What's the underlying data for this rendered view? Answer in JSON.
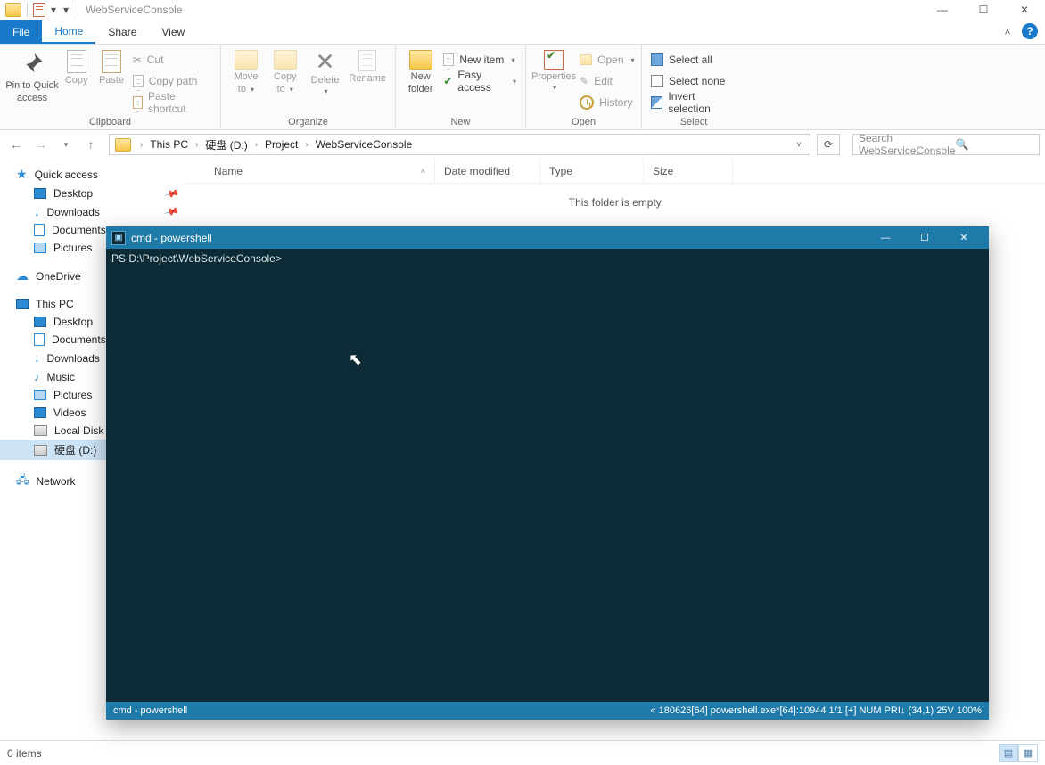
{
  "window": {
    "title": "WebServiceConsole"
  },
  "tabs": {
    "file": "File",
    "home": "Home",
    "share": "Share",
    "view": "View"
  },
  "ribbon": {
    "pin": {
      "l1": "Pin to Quick",
      "l2": "access"
    },
    "copy": "Copy",
    "paste": "Paste",
    "cut": "Cut",
    "copy_path": "Copy path",
    "paste_shortcut": "Paste shortcut",
    "clipboard_label": "Clipboard",
    "move_to": {
      "l1": "Move",
      "l2": "to"
    },
    "copy_to": {
      "l1": "Copy",
      "l2": "to"
    },
    "delete": "Delete",
    "rename": "Rename",
    "organize_label": "Organize",
    "new_folder": {
      "l1": "New",
      "l2": "folder"
    },
    "new_item": "New item",
    "easy_access": "Easy access",
    "new_label": "New",
    "properties": "Properties",
    "open": "Open",
    "edit": "Edit",
    "history": "History",
    "open_label": "Open",
    "select_all": "Select all",
    "select_none": "Select none",
    "invert_selection": "Invert selection",
    "select_label": "Select"
  },
  "breadcrumb": {
    "parts": [
      "This PC",
      "硬盘 (D:)",
      "Project",
      "WebServiceConsole"
    ]
  },
  "search": {
    "placeholder": "Search WebServiceConsole"
  },
  "columns": {
    "name": "Name",
    "date": "Date modified",
    "type": "Type",
    "size": "Size"
  },
  "empty_message": "This folder is empty.",
  "sidebar": {
    "quick_access": "Quick access",
    "qa_items": [
      "Desktop",
      "Downloads",
      "Documents",
      "Pictures"
    ],
    "onedrive": "OneDrive",
    "this_pc": "This PC",
    "pc_items": [
      "Desktop",
      "Documents",
      "Downloads",
      "Music",
      "Pictures",
      "Videos",
      "Local Disk (C:",
      "硬盘 (D:)"
    ],
    "network": "Network"
  },
  "statusbar": {
    "items": "0 items"
  },
  "console": {
    "title": "cmd - powershell",
    "prompt": "PS D:\\Project\\WebServiceConsole>",
    "status_left": "cmd - powershell",
    "status_right": "« 180626[64]  powershell.exe*[64]:10944    1/1   [+]  NUM   PRI↓           (34,1) 25V        100%"
  }
}
